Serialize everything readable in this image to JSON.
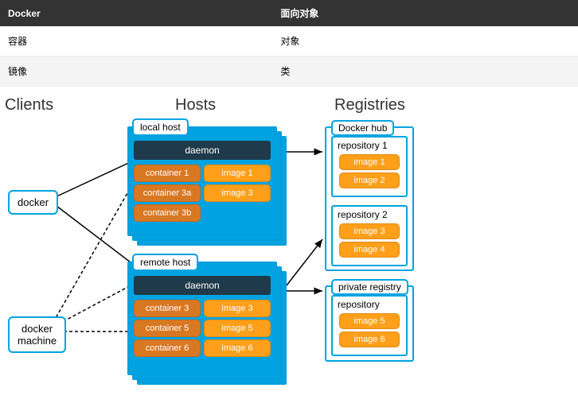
{
  "table": {
    "headers": [
      "Docker",
      "面向对象"
    ],
    "rows": [
      [
        "容器",
        "对象"
      ],
      [
        "镜像",
        "类"
      ]
    ]
  },
  "columns": {
    "clients": "Clients",
    "hosts": "Hosts",
    "registries": "Registries"
  },
  "clients": {
    "docker": "docker",
    "machine": "docker\nmachine"
  },
  "hosts": {
    "local": {
      "label": "local host",
      "daemon": "daemon",
      "items": [
        "container 1",
        "image 1",
        "container 3a",
        "image 3",
        "container 3b"
      ]
    },
    "remote": {
      "label": "remote host",
      "daemon": "daemon",
      "items": [
        "container 3",
        "image 3",
        "container 5",
        "image 5",
        "container 6",
        "image 6"
      ]
    }
  },
  "registries": {
    "hub": {
      "label": "Docker hub",
      "repos": [
        {
          "name": "repository 1",
          "images": [
            "image 1",
            "image 2"
          ]
        },
        {
          "name": "repository 2",
          "images": [
            "image 3",
            "image 4"
          ]
        }
      ]
    },
    "private": {
      "label": "private registry",
      "repos": [
        {
          "name": "repository",
          "images": [
            "image 5",
            "image 6"
          ]
        }
      ]
    }
  }
}
